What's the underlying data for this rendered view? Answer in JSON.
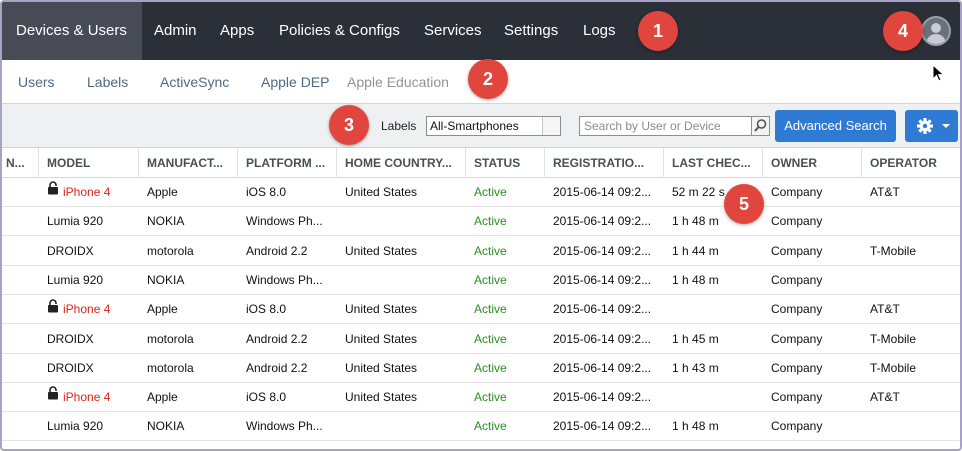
{
  "topnav": {
    "tabs": [
      {
        "label": "Devices & Users"
      },
      {
        "label": "Admin"
      },
      {
        "label": "Apps"
      },
      {
        "label": "Policies & Configs"
      },
      {
        "label": "Services"
      },
      {
        "label": "Settings"
      },
      {
        "label": "Logs"
      }
    ],
    "active_tab": "Devices & Users"
  },
  "subnav": {
    "tabs": [
      {
        "label": "Users"
      },
      {
        "label": "Labels"
      },
      {
        "label": "ActiveSync"
      },
      {
        "label": "Apple DEP"
      },
      {
        "label": "Apple Education"
      }
    ],
    "selected_tab": "Apple Education"
  },
  "callouts": [
    "1",
    "2",
    "3",
    "4",
    "5"
  ],
  "toolbar": {
    "labels_label": "Labels",
    "labels_value": "All-Smartphones",
    "search_placeholder": "Search by User or Device",
    "advanced_search_label": "Advanced Search",
    "gear_icon": "gear-icon"
  },
  "table": {
    "headers": [
      "N...",
      "MODEL",
      "MANUFACT...",
      "PLATFORM ...",
      "HOME COUNTRY...",
      "STATUS",
      "REGISTRATIO...",
      "LAST CHEC...",
      "OWNER",
      "OPERATOR"
    ],
    "rows": [
      {
        "locked": true,
        "model": "iPhone 4",
        "manufacturer": "Apple",
        "platform": "iOS 8.0",
        "country": "United States",
        "status": "Active",
        "registration": "2015-06-14 09:2...",
        "last_check": "52 m 22 s",
        "owner": "Company",
        "operator": "AT&T"
      },
      {
        "locked": false,
        "model": "Lumia 920",
        "manufacturer": "NOKIA",
        "platform": "Windows Ph...",
        "country": "",
        "status": "Active",
        "registration": "2015-06-14 09:2...",
        "last_check": "1 h 48 m",
        "owner": "Company",
        "operator": ""
      },
      {
        "locked": false,
        "model": "DROIDX",
        "manufacturer": "motorola",
        "platform": "Android 2.2",
        "country": "United States",
        "status": "Active",
        "registration": "2015-06-14 09:2...",
        "last_check": "1 h 44 m",
        "owner": "Company",
        "operator": "T-Mobile"
      },
      {
        "locked": false,
        "model": "Lumia 920",
        "manufacturer": "NOKIA",
        "platform": "Windows Ph...",
        "country": "",
        "status": "Active",
        "registration": "2015-06-14 09:2...",
        "last_check": "1 h 48 m",
        "owner": "Company",
        "operator": ""
      },
      {
        "locked": true,
        "model": "iPhone 4",
        "manufacturer": "Apple",
        "platform": "iOS 8.0",
        "country": "United States",
        "status": "Active",
        "registration": "2015-06-14 09:2...",
        "last_check": "",
        "owner": "Company",
        "operator": "AT&T"
      },
      {
        "locked": false,
        "model": "DROIDX",
        "manufacturer": "motorola",
        "platform": "Android 2.2",
        "country": "United States",
        "status": "Active",
        "registration": "2015-06-14 09:2...",
        "last_check": "1 h 45 m",
        "owner": "Company",
        "operator": "T-Mobile"
      },
      {
        "locked": false,
        "model": "DROIDX",
        "manufacturer": "motorola",
        "platform": "Android 2.2",
        "country": "United States",
        "status": "Active",
        "registration": "2015-06-14 09:2...",
        "last_check": "1 h 43 m",
        "owner": "Company",
        "operator": "T-Mobile"
      },
      {
        "locked": true,
        "model": "iPhone 4",
        "manufacturer": "Apple",
        "platform": "iOS 8.0",
        "country": "United States",
        "status": "Active",
        "registration": "2015-06-14 09:2...",
        "last_check": "",
        "owner": "Company",
        "operator": "AT&T"
      },
      {
        "locked": false,
        "model": "Lumia 920",
        "manufacturer": "NOKIA",
        "platform": "Windows Ph...",
        "country": "",
        "status": "Active",
        "registration": "2015-06-14 09:2...",
        "last_check": "1 h 48 m",
        "owner": "Company",
        "operator": ""
      }
    ]
  },
  "colors": {
    "nav_bg": "#2b2f38",
    "nav_active": "#464b55",
    "callout": "#e0463d",
    "primary_button": "#2f7ad2",
    "status_active": "#2a8f1e",
    "locked_model": "#d9231b"
  }
}
